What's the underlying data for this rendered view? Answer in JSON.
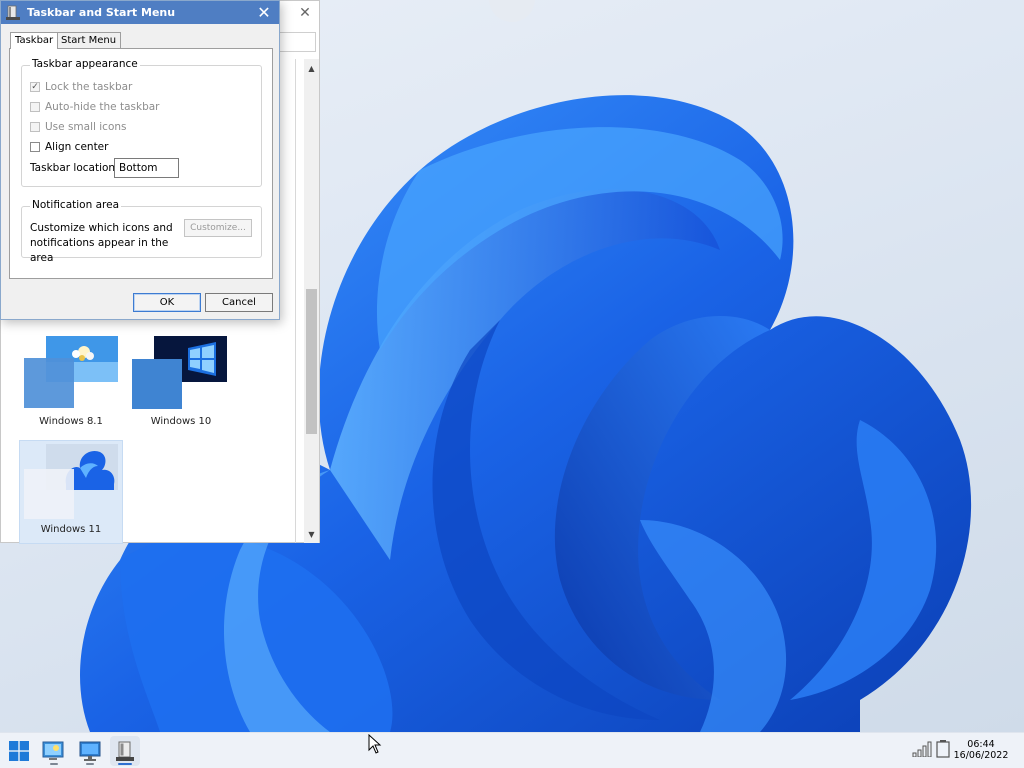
{
  "dialog": {
    "title": "Taskbar and Start Menu",
    "tabs": [
      "Taskbar",
      "Start Menu"
    ],
    "active_tab": "Taskbar",
    "taskbar_appearance": {
      "legend": "Taskbar appearance",
      "lock_taskbar": "Lock the taskbar",
      "auto_hide": "Auto-hide the taskbar",
      "small_icons": "Use small icons",
      "align_center": "Align center",
      "location_label": "Taskbar location:",
      "location_value": "Bottom"
    },
    "notification_area": {
      "legend": "Notification area",
      "description": "Customize which icons and notifications appear in the area",
      "customize_label": "Customize..."
    },
    "ok_label": "OK",
    "cancel_label": "Cancel"
  },
  "themes": {
    "items": [
      {
        "label": "Windows 8.1"
      },
      {
        "label": "Windows 10"
      },
      {
        "label": "Windows 11",
        "selected": true
      }
    ]
  },
  "taskbar": {
    "time": "06:44",
    "date": "16/06/2022"
  },
  "colors": {
    "accent": "#4f7ec3",
    "wallpaper_bloom": "#1a63e6"
  }
}
